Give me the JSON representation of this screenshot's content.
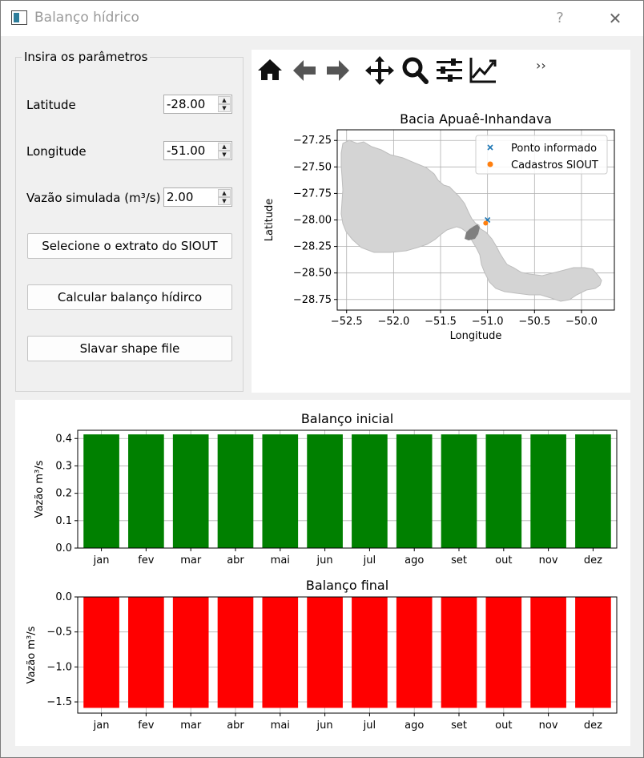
{
  "window": {
    "title": "Balanço hídrico",
    "help": "?",
    "close": "✕"
  },
  "params": {
    "group_title": "Insira os parâmetros",
    "latitude": {
      "label": "Latitude",
      "value": "-28.00"
    },
    "longitude": {
      "label": "Longitude",
      "value": "-51.00"
    },
    "vazao": {
      "label": "Vazão simulada (m³/s)",
      "value": "2.00"
    },
    "buttons": {
      "select": "Selecione o extrato do SIOUT",
      "calc": "Calcular balanço hídirco",
      "save": "Slavar shape file"
    }
  },
  "toolbar": {
    "icons": [
      "home-icon",
      "back-arrow-icon",
      "forward-arrow-icon",
      "pan-icon",
      "zoom-icon",
      "configure-subplots-icon",
      "edit-axis-icon"
    ],
    "overflow": "››"
  },
  "chart_data": [
    {
      "type": "scatter",
      "title": "Bacia Apuaê-Inhandava",
      "xlabel": "Longitude",
      "ylabel": "Latitude",
      "xlim": [
        -52.6,
        -49.65
      ],
      "ylim": [
        -28.85,
        -27.15
      ],
      "xticks": [
        "−52.5",
        "−52.0",
        "−51.5",
        "−51.0",
        "−50.5",
        "−50.0"
      ],
      "yticks": [
        "−27.25",
        "−27.50",
        "−27.75",
        "−28.00",
        "−28.25",
        "−28.50",
        "−28.75"
      ],
      "grid": true,
      "legend": "top-right",
      "series": [
        {
          "name": "Ponto informado",
          "points": [
            [
              -51.0,
              -28.0
            ]
          ],
          "marker": "x",
          "color": "#1f77b4"
        },
        {
          "name": "Cadastros SIOUT",
          "points": [
            [
              -51.02,
              -28.03
            ]
          ],
          "marker": "o",
          "color": "#ff7f0e"
        }
      ],
      "colors": {
        "basin": "#d4d4d4",
        "basin_edge": "#bdbdbd",
        "subbasin": "#808080"
      }
    },
    {
      "type": "bar",
      "title": "Balanço inicial",
      "ylabel": "Vazão m³/s",
      "categories": [
        "jan",
        "fev",
        "mar",
        "abr",
        "mai",
        "jun",
        "jul",
        "ago",
        "set",
        "out",
        "nov",
        "dez"
      ],
      "values": [
        0.415,
        0.415,
        0.415,
        0.415,
        0.415,
        0.415,
        0.415,
        0.415,
        0.415,
        0.415,
        0.415,
        0.415
      ],
      "ylim": [
        0.0,
        0.43
      ],
      "yticks": [
        "0.0",
        "0.1",
        "0.2",
        "0.3",
        "0.4"
      ],
      "color": "#008000",
      "grid": true
    },
    {
      "type": "bar",
      "title": "Balanço final",
      "ylabel": "Vazão m³/s",
      "categories": [
        "jan",
        "fev",
        "mar",
        "abr",
        "mai",
        "jun",
        "jul",
        "ago",
        "set",
        "out",
        "nov",
        "dez"
      ],
      "values": [
        -1.585,
        -1.585,
        -1.585,
        -1.585,
        -1.585,
        -1.585,
        -1.585,
        -1.585,
        -1.585,
        -1.585,
        -1.585,
        -1.585
      ],
      "ylim": [
        -1.66,
        0.0
      ],
      "yticks": [
        "0.0",
        "−0.5",
        "−1.0",
        "−1.5"
      ],
      "color": "#ff0000",
      "grid": true
    }
  ]
}
